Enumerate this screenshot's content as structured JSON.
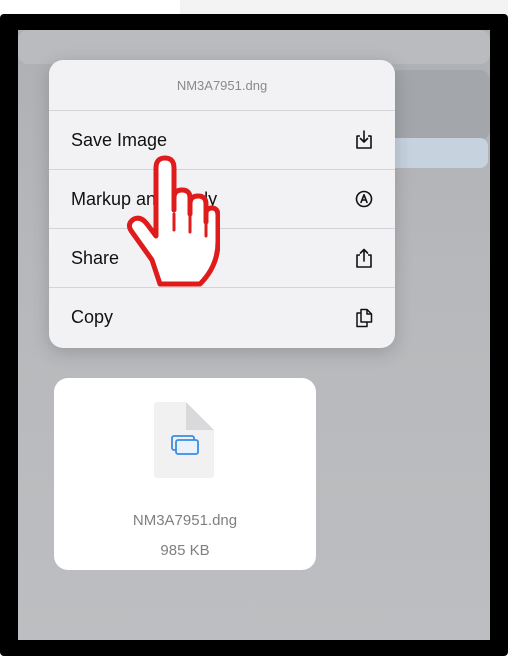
{
  "menu": {
    "title": "NM3A7951.dng",
    "items": [
      {
        "label": "Save Image",
        "icon": "save-icon"
      },
      {
        "label": "Markup and Reply",
        "icon": "markup-icon"
      },
      {
        "label": "Share",
        "icon": "share-icon"
      },
      {
        "label": "Copy",
        "icon": "copy-icon"
      }
    ]
  },
  "file": {
    "name": "NM3A7951.dng",
    "size": "985 KB",
    "icon": "document-icon"
  },
  "overlay": {
    "icon": "pointing-hand-icon",
    "color": "#e01b1b"
  }
}
